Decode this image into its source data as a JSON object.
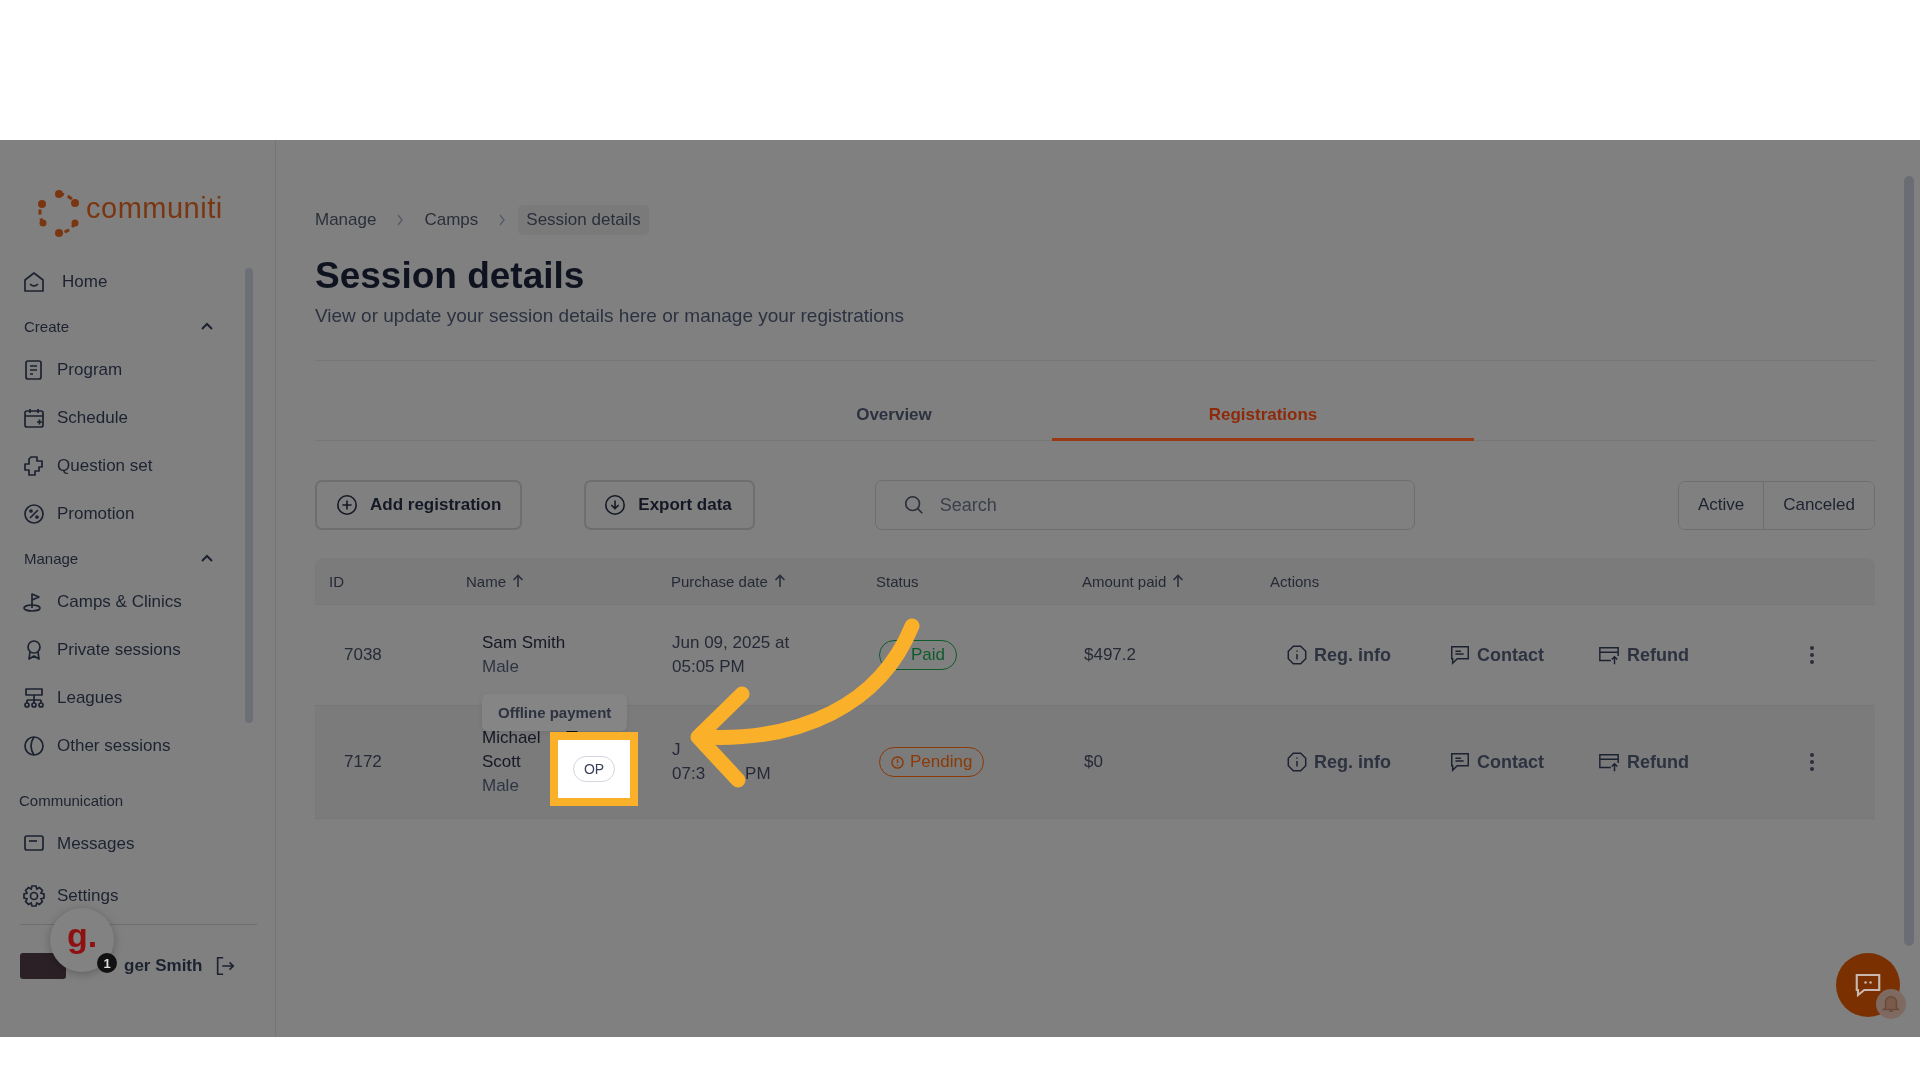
{
  "sidebar": {
    "logo": "communiti",
    "nav": [
      {
        "kind": "link",
        "label": "Home"
      },
      {
        "kind": "section",
        "label": "Create",
        "expanded": true
      },
      {
        "kind": "link",
        "label": "Program"
      },
      {
        "kind": "link",
        "label": "Schedule"
      },
      {
        "kind": "link",
        "label": "Question set"
      },
      {
        "kind": "link",
        "label": "Promotion"
      },
      {
        "kind": "section",
        "label": "Manage",
        "expanded": true
      },
      {
        "kind": "link",
        "label": "Camps & Clinics"
      },
      {
        "kind": "link",
        "label": "Private sessions"
      },
      {
        "kind": "link",
        "label": "Leagues"
      },
      {
        "kind": "link",
        "label": "Other sessions"
      },
      {
        "kind": "section",
        "label": "Communication"
      },
      {
        "kind": "link",
        "label": "Messages"
      }
    ],
    "settings": "Settings",
    "user": {
      "name": "ger Smith",
      "assistant": "g.",
      "notifications": "1"
    }
  },
  "breadcrumb": [
    "Manage",
    "Camps",
    "Session details"
  ],
  "title": "Session details",
  "subtitle": "View or update your session details here or manage your registrations",
  "tabs": [
    {
      "label": "Overview",
      "selected": false
    },
    {
      "label": "Registrations",
      "selected": true
    }
  ],
  "buttons": [
    {
      "label": "Add registration"
    },
    {
      "label": "Export data"
    }
  ],
  "search": {
    "placeholder": "Search"
  },
  "filters": [
    {
      "label": "Active"
    },
    {
      "label": "Canceled"
    }
  ],
  "table": {
    "columns": [
      {
        "label": "ID",
        "sortable": false
      },
      {
        "label": "Name",
        "sortable": true
      },
      {
        "label": "Purchase date",
        "sortable": true
      },
      {
        "label": "Status",
        "sortable": false
      },
      {
        "label": "Amount paid",
        "sortable": true
      },
      {
        "label": "Actions",
        "sortable": false
      }
    ],
    "rows": [
      {
        "id": "7038",
        "name": "Sam Smith",
        "gender": "Male",
        "date_lines": [
          [
            "Jun 09, 2025 at"
          ],
          [
            "05:05 PM"
          ]
        ],
        "status": {
          "label": "Paid",
          "kind": "paid"
        },
        "amount": "$497.2",
        "actions": [
          "Reg. info",
          "Contact",
          "Refund"
        ]
      },
      {
        "id": "7172",
        "name": "Michael Scott",
        "gender": "Male",
        "badge": {
          "label": "OP",
          "tooltip": "Offline payment"
        },
        "date_lines": [
          [
            "J"
          ],
          [
            "07:3",
            "PM"
          ]
        ],
        "status": {
          "label": "Pending",
          "kind": "pending"
        },
        "amount": "$0",
        "actions": [
          "Reg. info",
          "Contact",
          "Refund"
        ]
      }
    ]
  }
}
